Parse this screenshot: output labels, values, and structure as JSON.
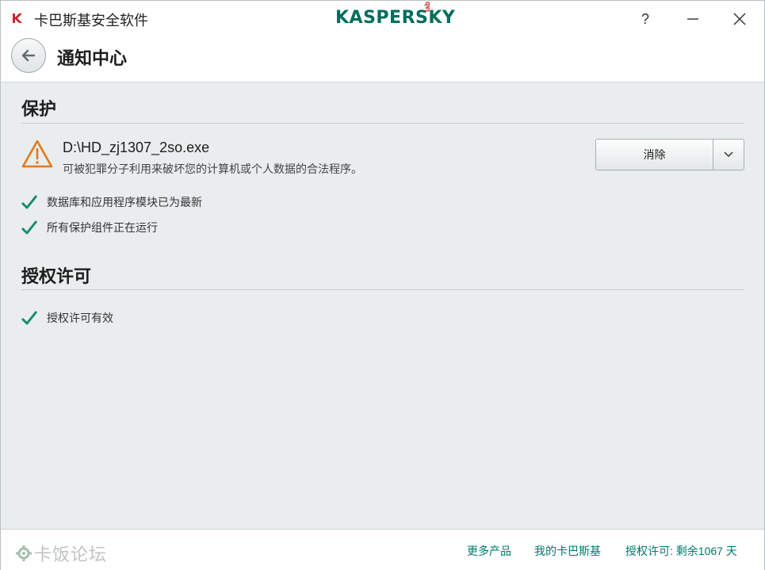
{
  "titlebar": {
    "app_title": "卡巴斯基安全软件",
    "brand": "KASPERSKY",
    "brand_suffix": "lab",
    "help": "?",
    "minimize": "—",
    "close": "✕"
  },
  "header": {
    "page_title": "通知中心",
    "back_icon": "arrow-left-icon"
  },
  "protection": {
    "title": "保护",
    "threat": {
      "name": "D:\\HD_zj1307_2so.exe",
      "description": "可被犯罪分子利用来破坏您的计算机或个人数据的合法程序。",
      "icon": "warning-triangle-icon",
      "action_label": "消除"
    },
    "statuses": [
      {
        "label": "数据库和应用程序模块已为最新",
        "icon": "check-icon"
      },
      {
        "label": "所有保护组件正在运行",
        "icon": "check-icon"
      }
    ]
  },
  "license": {
    "title": "授权许可",
    "statuses": [
      {
        "label": "授权许可有效",
        "icon": "check-icon"
      }
    ]
  },
  "footer": {
    "watermark": "卡饭论坛",
    "more_products": "更多产品",
    "my_kaspersky": "我的卡巴斯基",
    "license_status": "授权许可: 剩余1067 天"
  },
  "colors": {
    "accent": "#006d5c",
    "warning": "#e07a1f",
    "check": "#1a8a72",
    "link": "#00796b"
  }
}
